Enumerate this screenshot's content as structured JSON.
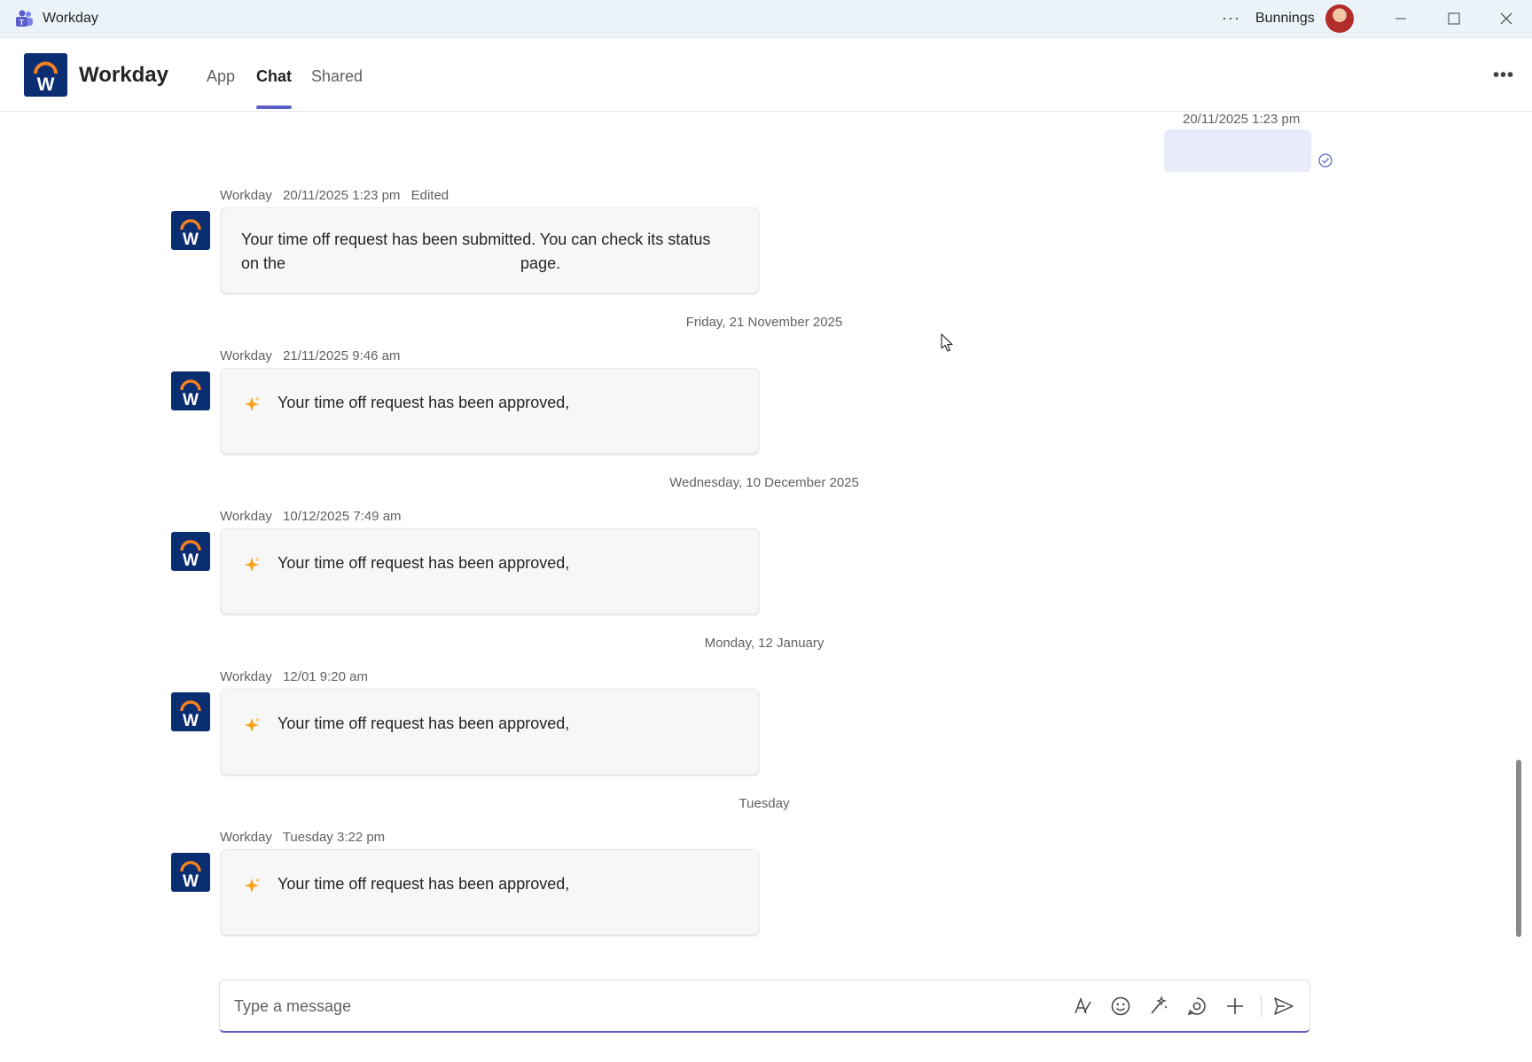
{
  "window": {
    "title": "Workday",
    "org_name": "Bunnings",
    "more_label": "···"
  },
  "header": {
    "app_name": "Workday",
    "tabs": [
      {
        "label": "App",
        "active": false
      },
      {
        "label": "Chat",
        "active": true
      },
      {
        "label": "Shared",
        "active": false
      }
    ],
    "more_label": "•••"
  },
  "conversation": {
    "sent": {
      "timestamp": "20/11/2025 1:23 pm",
      "status_icon": "read-check-icon"
    },
    "messages": [
      {
        "sender": "Workday",
        "timestamp": "20/11/2025 1:23 pm",
        "edited": "Edited",
        "line1": "Your time off request has been submitted. You can check its status",
        "line2_start": "on the",
        "line2_end": "page."
      },
      {
        "sender": "Workday",
        "timestamp": "21/11/2025 9:46 am",
        "text": "Your time off request has been approved,",
        "icon": "sparkle-icon"
      },
      {
        "sender": "Workday",
        "timestamp": "10/12/2025 7:49 am",
        "text": "Your time off request has been approved,",
        "icon": "sparkle-icon"
      },
      {
        "sender": "Workday",
        "timestamp": "12/01 9:20 am",
        "text": "Your time off request has been approved,",
        "icon": "sparkle-icon"
      },
      {
        "sender": "Workday",
        "timestamp": "Tuesday 3:22 pm",
        "text": "Your time off request has been approved,",
        "icon": "sparkle-icon"
      }
    ],
    "dividers": [
      "Friday, 21 November 2025",
      "Wednesday, 10 December 2025",
      "Monday, 12 January",
      "Tuesday"
    ]
  },
  "compose": {
    "placeholder": "Type a message",
    "tools": [
      "format-icon",
      "emoji-icon",
      "copilot-icon",
      "loop-icon",
      "attach-plus-icon",
      "send-icon"
    ]
  },
  "colors": {
    "accent": "#5b5fc7",
    "brand_navy": "#0b2d71",
    "brand_orange": "#f5821f",
    "sent_bubble": "#e8ebfa",
    "titlebar_bg": "#ebf3f8"
  }
}
